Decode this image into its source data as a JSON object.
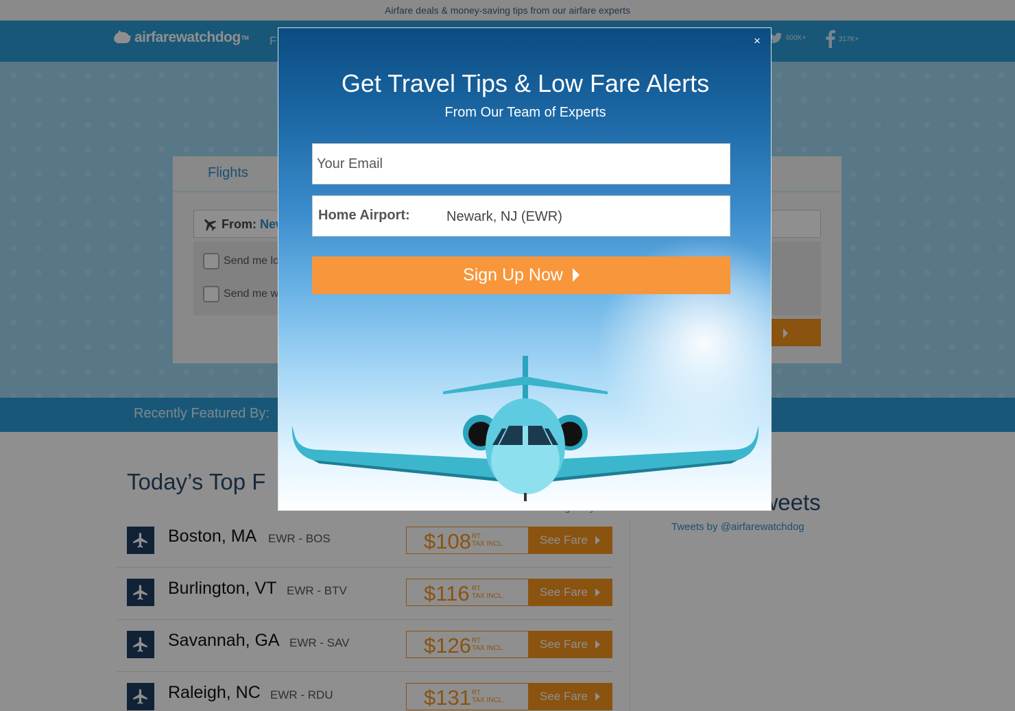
{
  "topbar": {
    "text": "Airfare deals & money-saving tips from our airfare experts"
  },
  "header": {
    "logo": "airfarewatchdog",
    "logo_tm": "TM",
    "nav_first": "F",
    "twitter_count": "600K+",
    "facebook_count": "317K+"
  },
  "search": {
    "tab_flights": "Flights",
    "from_label": "From:",
    "from_value": "New",
    "option_1": "Send me lo",
    "option_2": "Send me w"
  },
  "featured": {
    "label": "Recently Featured By:"
  },
  "fares": {
    "title": "Today’s Top F",
    "change_city": "Change City",
    "rows": [
      {
        "city": "Boston, MA",
        "code": "EWR - BOS",
        "price": "$108",
        "rt": "RT",
        "tax": "TAX INCL.",
        "button": "See Fare"
      },
      {
        "city": "Burlington, VT",
        "code": "EWR - BTV",
        "price": "$116",
        "rt": "RT",
        "tax": "TAX INCL.",
        "button": "See Fare"
      },
      {
        "city": "Savannah, GA",
        "code": "EWR - SAV",
        "price": "$126",
        "rt": "RT",
        "tax": "TAX INCL.",
        "button": "See Fare"
      },
      {
        "city": "Raleigh, NC",
        "code": "EWR - RDU",
        "price": "$131",
        "rt": "RT",
        "tax": "TAX INCL.",
        "button": "See Fare"
      }
    ]
  },
  "tweets": {
    "title": "Recent Tweets",
    "by": "Tweets by @airfarewatchdog"
  },
  "modal": {
    "close": "×",
    "title": "Get Travel Tips & Low Fare Alerts",
    "subtitle": "From Our Team of Experts",
    "email_placeholder": "Your Email",
    "airport_label": "Home Airport:",
    "airport_value": "Newark, NJ (EWR)",
    "button": "Sign Up Now"
  },
  "colors": {
    "brand_blue": "#2d9bd6",
    "accent_orange": "#f7941e",
    "navy": "#1f3d62"
  }
}
